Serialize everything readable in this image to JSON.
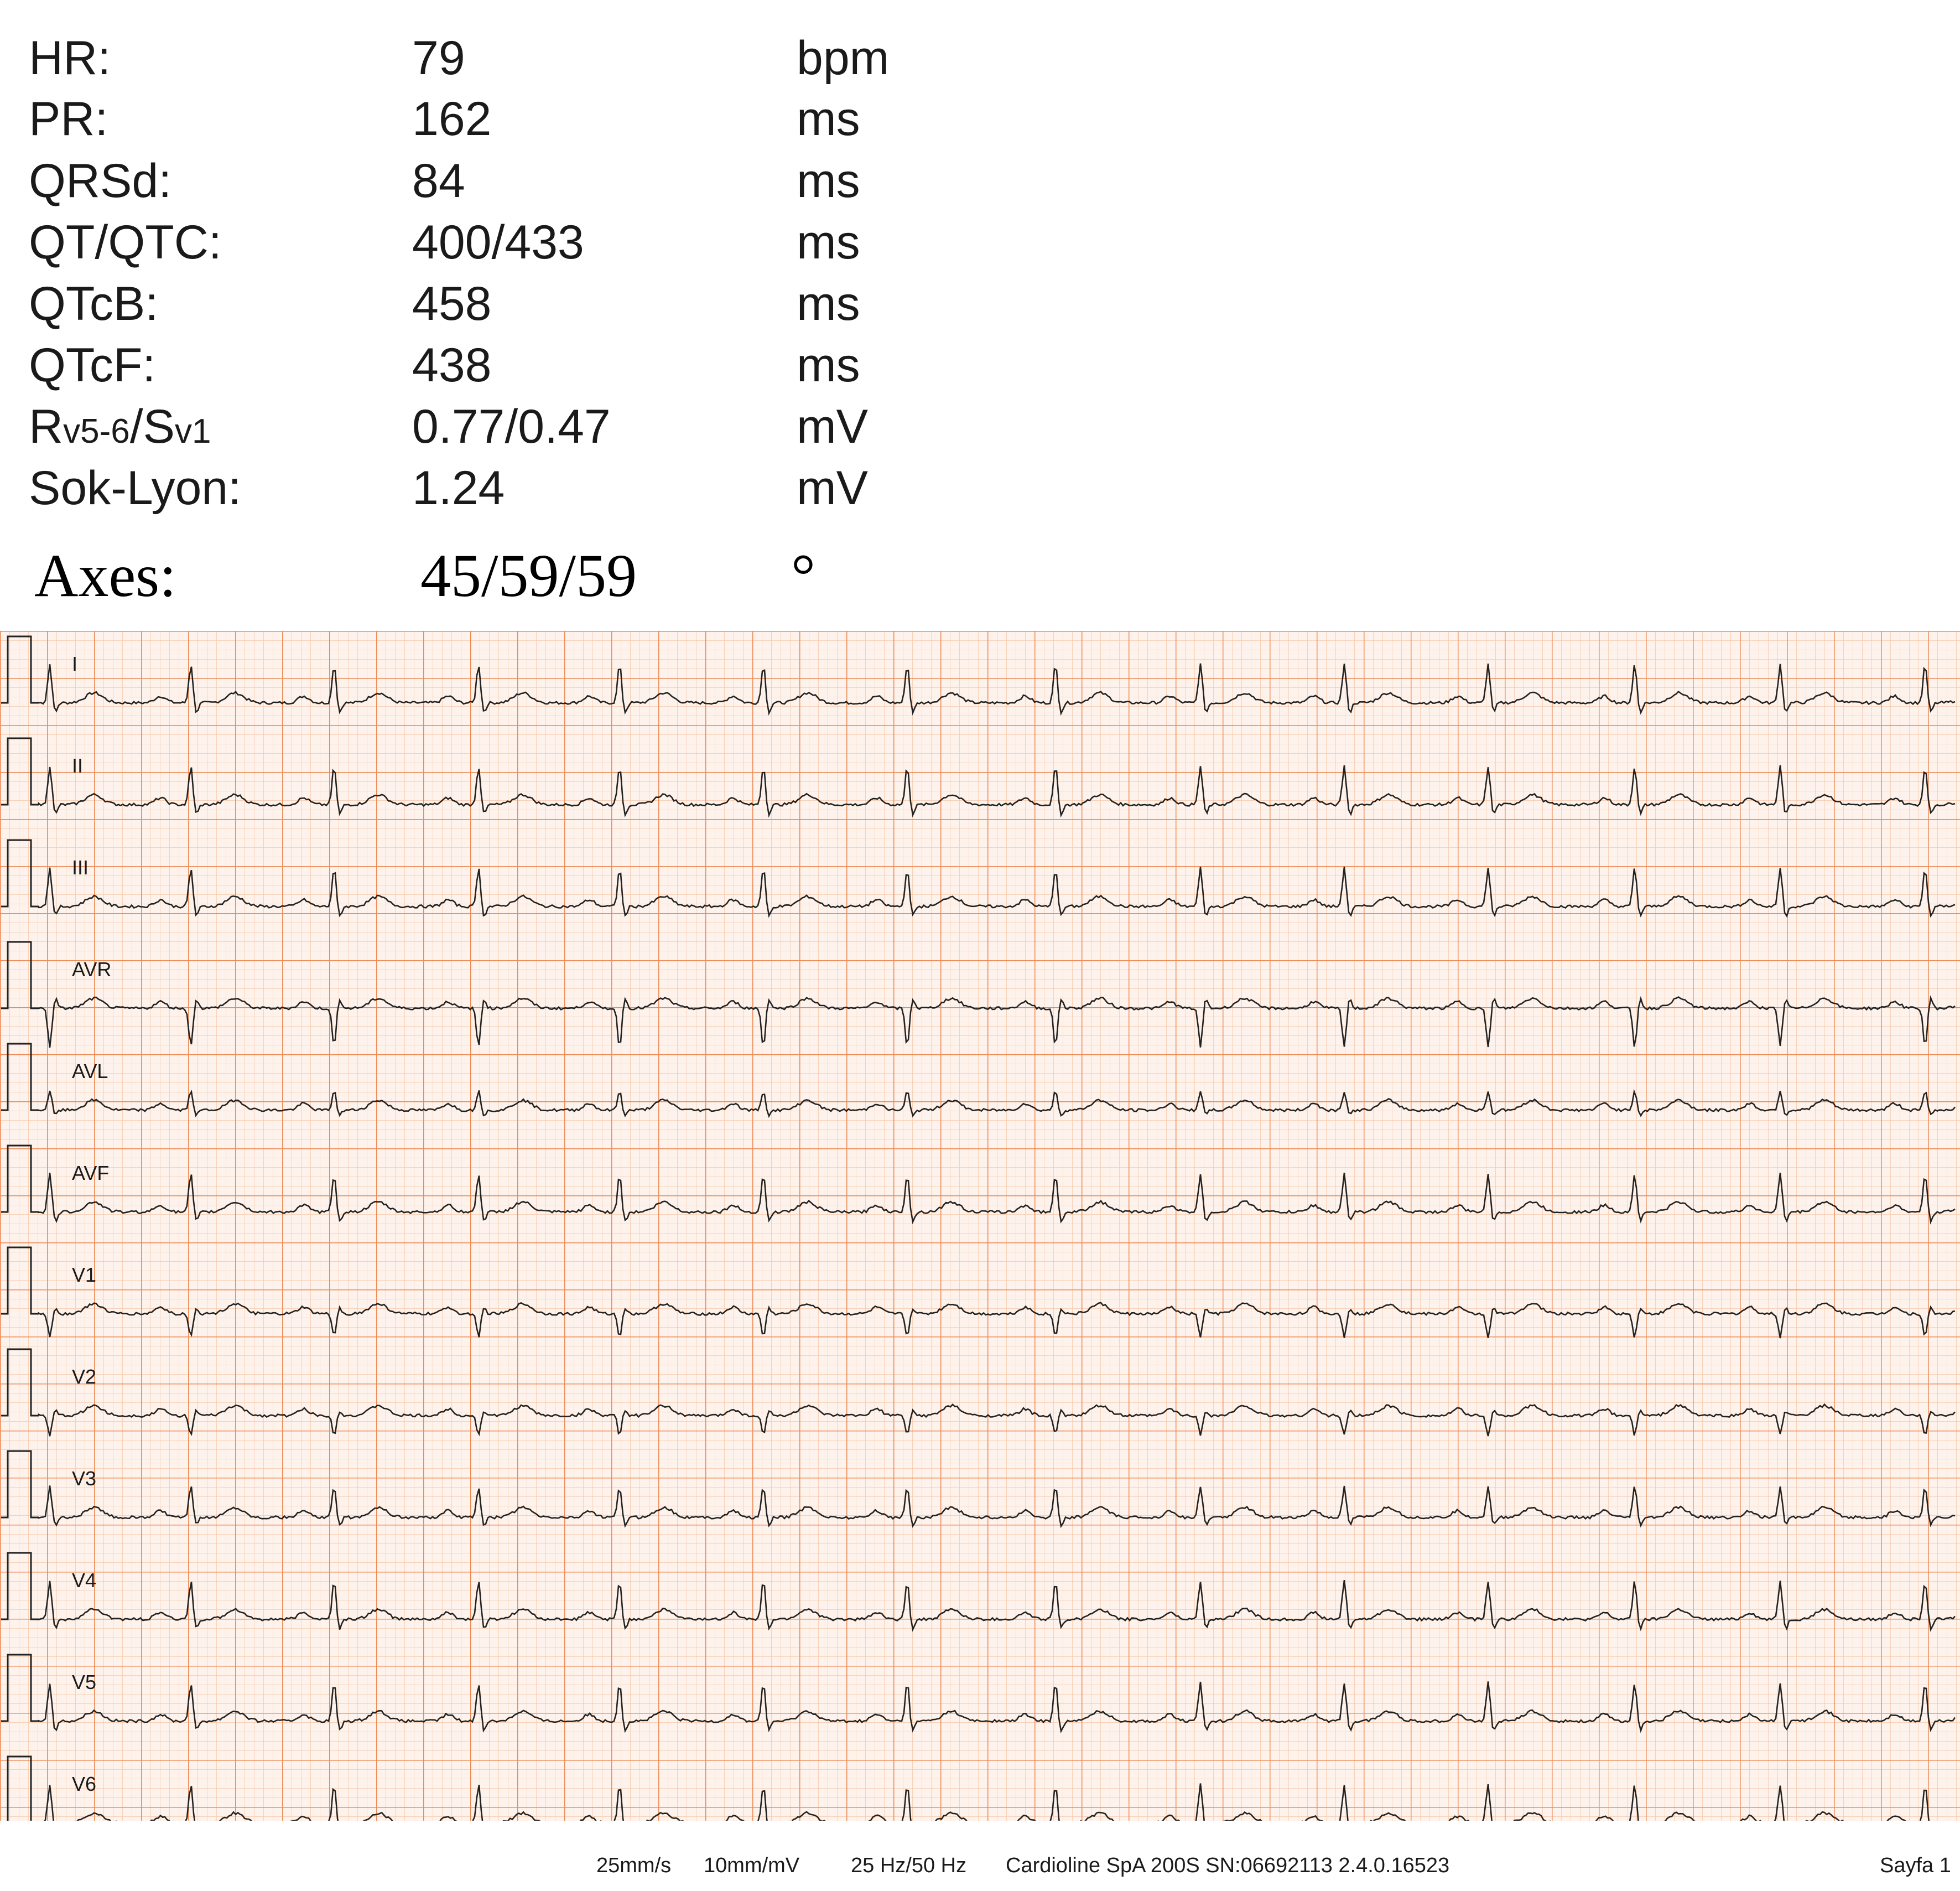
{
  "measurements": [
    {
      "label": "HR:",
      "value": "79",
      "unit": "bpm"
    },
    {
      "label": "PR:",
      "value": "162",
      "unit": "ms"
    },
    {
      "label": "QRSd:",
      "value": "84",
      "unit": "ms"
    },
    {
      "label": "QT/QTC:",
      "value": "400/433",
      "unit": "ms"
    },
    {
      "label": "QTcB:",
      "value": "458",
      "unit": "ms"
    },
    {
      "label": "QTcF:",
      "value": "438",
      "unit": "ms"
    },
    {
      "label_parts": [
        "R",
        "v5-6",
        "/S",
        "v1"
      ],
      "value": "0.77/0.47",
      "unit": "mV"
    },
    {
      "label": "Sok-Lyon:",
      "value": "1.24",
      "unit": "mV"
    }
  ],
  "axes": {
    "label": "Axes:",
    "value": "45/59/59",
    "unit": "°"
  },
  "leads": [
    "I",
    "II",
    "III",
    "AVR",
    "AVL",
    "AVF",
    "V1",
    "V2",
    "V3",
    "V4",
    "V5",
    "V6"
  ],
  "footer": {
    "speed": "25mm/s",
    "gain": "10mm/mV",
    "filter": "25 Hz/50 Hz",
    "device": "Cardioline SpA 200S SN:06692113 2.4.0.16523",
    "page": "Sayfa 1"
  },
  "colors": {
    "grid_minor": "#f7c7a8",
    "grid_major": "#ec8a55",
    "paper": "#fdf3ec",
    "trace": "#222222"
  }
}
